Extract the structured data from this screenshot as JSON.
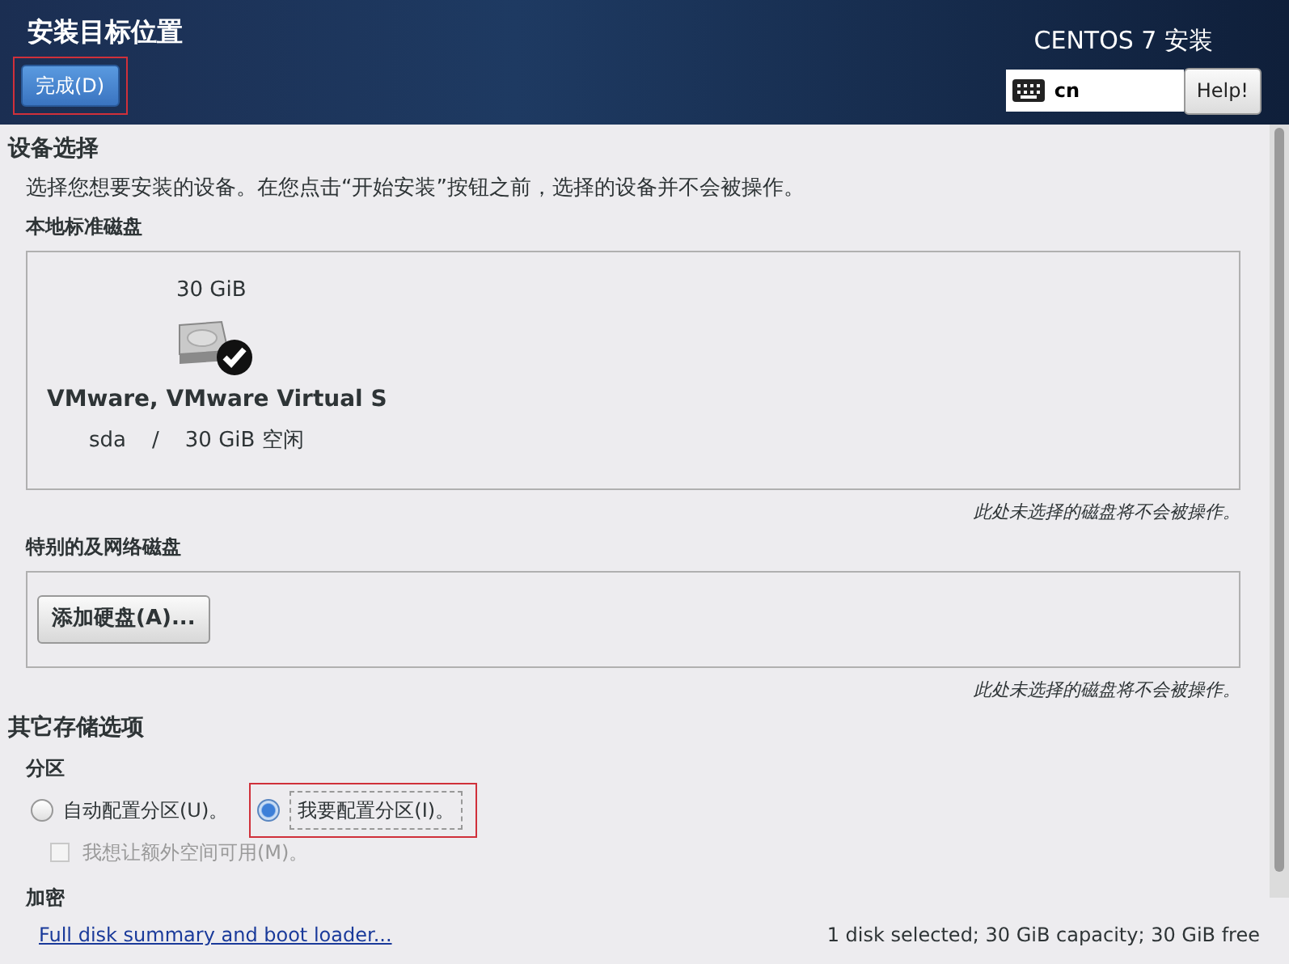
{
  "header": {
    "title": "安装目标位置",
    "done_button": {
      "label": "完成(D)",
      "highlighted": true
    },
    "product": "CENTOS 7 安装",
    "keyboard_layout": "cn",
    "help_button": "Help!"
  },
  "device_selection": {
    "title": "设备选择",
    "description": "选择您想要安装的设备。在您点击“开始安装”按钮之前，选择的设备并不会被操作。",
    "local_disks": {
      "label": "本地标准磁盘",
      "disks": [
        {
          "size": "30 GiB",
          "name": "VMware, VMware Virtual S",
          "device": "sda",
          "separator": "/",
          "free": "30 GiB 空闲",
          "selected": true
        }
      ],
      "note": "此处未选择的磁盘将不会被操作。"
    },
    "special_disks": {
      "label": "特别的及网络磁盘",
      "add_button": "添加硬盘(A)...",
      "note": "此处未选择的磁盘将不会被操作。"
    }
  },
  "other_options": {
    "title": "其它存储选项",
    "partitioning": {
      "label": "分区",
      "options": [
        {
          "label": "自动配置分区(U)。",
          "selected": false,
          "highlighted": false
        },
        {
          "label": "我要配置分区(I)。",
          "selected": true,
          "highlighted": true
        }
      ],
      "extra_space": {
        "label": "我想让额外空间可用(M)。",
        "checked": false,
        "disabled": true
      }
    },
    "encryption": {
      "label": "加密"
    }
  },
  "footer": {
    "link": "Full disk summary and boot loader...",
    "summary": "1 disk selected; 30 GiB capacity; 30 GiB free"
  }
}
